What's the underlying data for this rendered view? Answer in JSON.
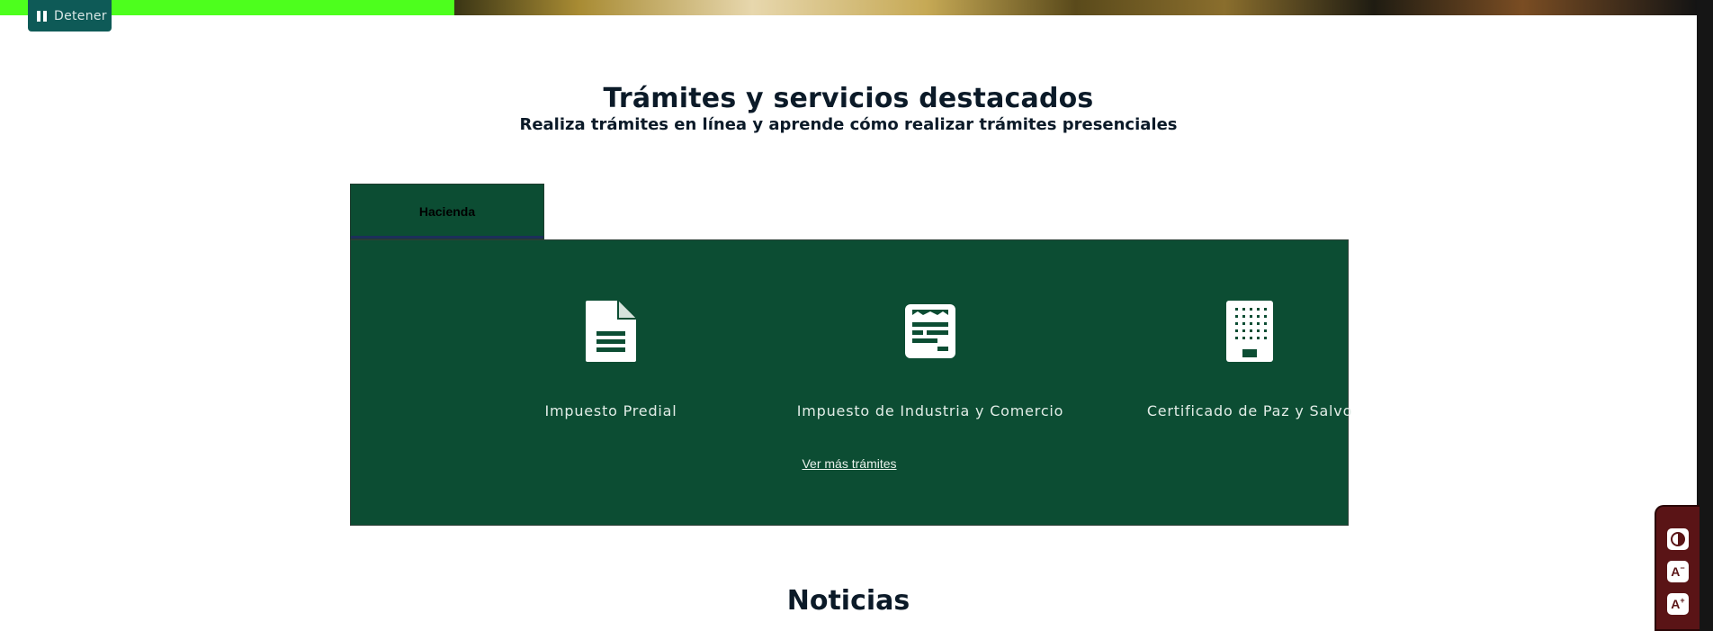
{
  "pause_button": {
    "label": "Detener"
  },
  "section": {
    "title": "Trámites y servicios destacados",
    "subtitle": "Realiza trámites en línea y aprende cómo realizar trámites presenciales"
  },
  "tabs": [
    {
      "label": "Hacienda",
      "active": true
    }
  ],
  "tramites": [
    {
      "label": "Impuesto Predial",
      "icon": "document-icon"
    },
    {
      "label": "Impuesto de Industria y Comercio",
      "icon": "receipt-form-icon"
    },
    {
      "label": "Certificado de Paz y Salvo",
      "icon": "building-icon"
    }
  ],
  "more_link": "Ver más trámites",
  "news": {
    "title": "Noticias"
  },
  "accessibility": {
    "buttons": [
      "contrast-icon",
      "decrease-text-icon",
      "increase-text-icon"
    ]
  },
  "colors": {
    "panel": "#0c4d33",
    "pause": "#0e5a57",
    "a11y": "#5a1416",
    "heading": "#0b1a28"
  }
}
